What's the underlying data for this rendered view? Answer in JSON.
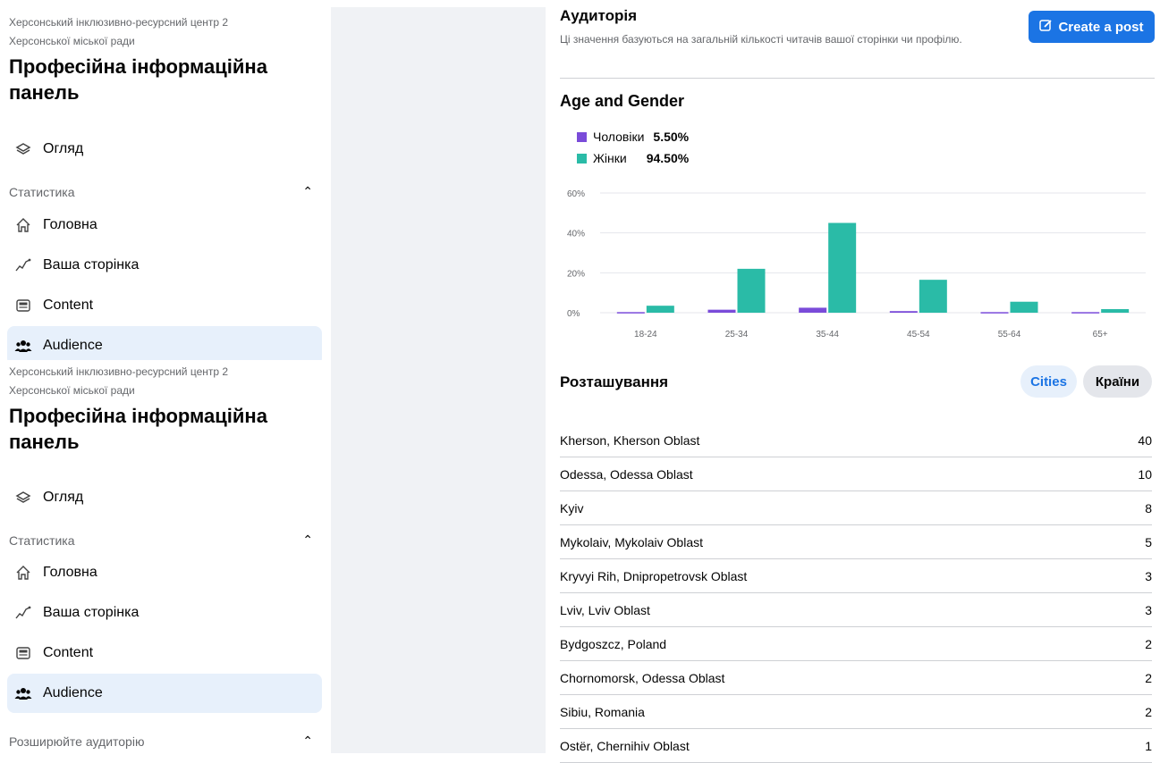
{
  "sidebar": {
    "org_line1": "Херсонський інклюзивно-ресурсний центр 2",
    "org_line2": "Херсонської міської ради",
    "title_line1": "Професійна інформаційна",
    "title_line2": "панель",
    "overview": "Огляд",
    "stats_section": "Статистика",
    "items": [
      {
        "label": "Головна",
        "icon": "home-icon"
      },
      {
        "label": "Ваша сторінка",
        "icon": "trend-icon"
      },
      {
        "label": "Content",
        "icon": "content-icon"
      },
      {
        "label": "Audience",
        "icon": "people-icon"
      }
    ],
    "grow_section": "Розширюйте аудиторію"
  },
  "audience": {
    "title": "Аудиторія",
    "subtitle": "Ці значення базуються на загальній кількості читачів вашої сторінки чи профілю.",
    "create_label": "Create a post"
  },
  "age_gender": {
    "title": "Age and Gender",
    "legend": [
      {
        "label": "Чоловіки",
        "pct": "5.50%",
        "color": "#7a4bd9"
      },
      {
        "label": "Жінки",
        "pct": "94.50%",
        "color": "#2abba7"
      }
    ]
  },
  "chart_data": {
    "type": "bar",
    "categories": [
      "18-24",
      "25-34",
      "35-44",
      "45-54",
      "55-64",
      "65+"
    ],
    "series": [
      {
        "name": "Чоловіки",
        "values": [
          0.3,
          1.5,
          2.5,
          0.8,
          0.3,
          0.3
        ],
        "color": "#7a4bd9"
      },
      {
        "name": "Жінки",
        "values": [
          3.5,
          22,
          45,
          16.5,
          5.5,
          1.8
        ],
        "color": "#2abba7"
      }
    ],
    "yticks": [
      "0%",
      "20%",
      "40%",
      "60%"
    ],
    "ylim": [
      0,
      60
    ],
    "grid": true
  },
  "location": {
    "title": "Розташування",
    "tab_cities": "Cities",
    "tab_countries": "Країни",
    "rows": [
      {
        "name": "Kherson, Kherson Oblast",
        "value": "40"
      },
      {
        "name": "Odessa, Odessa Oblast",
        "value": "10"
      },
      {
        "name": "Kyiv",
        "value": "8"
      },
      {
        "name": "Mykolaiv, Mykolaiv Oblast",
        "value": "5"
      },
      {
        "name": "Kryvyi Rih, Dnipropetrovsk Oblast",
        "value": "3"
      },
      {
        "name": "Lviv, Lviv Oblast",
        "value": "3"
      },
      {
        "name": "Bydgoszcz, Poland",
        "value": "2"
      },
      {
        "name": "Chornomorsk, Odessa Oblast",
        "value": "2"
      },
      {
        "name": "Sibiu, Romania",
        "value": "2"
      },
      {
        "name": "Ostër, Chernihiv Oblast",
        "value": "1"
      }
    ]
  }
}
